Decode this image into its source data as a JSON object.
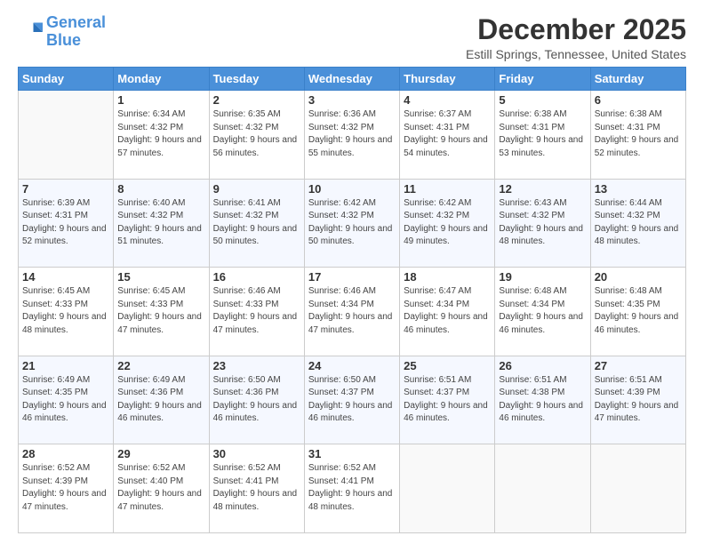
{
  "logo": {
    "line1": "General",
    "line2": "Blue"
  },
  "header": {
    "title": "December 2025",
    "subtitle": "Estill Springs, Tennessee, United States"
  },
  "weekdays": [
    "Sunday",
    "Monday",
    "Tuesday",
    "Wednesday",
    "Thursday",
    "Friday",
    "Saturday"
  ],
  "weeks": [
    [
      {
        "day": "",
        "sunrise": "",
        "sunset": "",
        "daylight": ""
      },
      {
        "day": "1",
        "sunrise": "Sunrise: 6:34 AM",
        "sunset": "Sunset: 4:32 PM",
        "daylight": "Daylight: 9 hours and 57 minutes."
      },
      {
        "day": "2",
        "sunrise": "Sunrise: 6:35 AM",
        "sunset": "Sunset: 4:32 PM",
        "daylight": "Daylight: 9 hours and 56 minutes."
      },
      {
        "day": "3",
        "sunrise": "Sunrise: 6:36 AM",
        "sunset": "Sunset: 4:32 PM",
        "daylight": "Daylight: 9 hours and 55 minutes."
      },
      {
        "day": "4",
        "sunrise": "Sunrise: 6:37 AM",
        "sunset": "Sunset: 4:31 PM",
        "daylight": "Daylight: 9 hours and 54 minutes."
      },
      {
        "day": "5",
        "sunrise": "Sunrise: 6:38 AM",
        "sunset": "Sunset: 4:31 PM",
        "daylight": "Daylight: 9 hours and 53 minutes."
      },
      {
        "day": "6",
        "sunrise": "Sunrise: 6:38 AM",
        "sunset": "Sunset: 4:31 PM",
        "daylight": "Daylight: 9 hours and 52 minutes."
      }
    ],
    [
      {
        "day": "7",
        "sunrise": "Sunrise: 6:39 AM",
        "sunset": "Sunset: 4:31 PM",
        "daylight": "Daylight: 9 hours and 52 minutes."
      },
      {
        "day": "8",
        "sunrise": "Sunrise: 6:40 AM",
        "sunset": "Sunset: 4:32 PM",
        "daylight": "Daylight: 9 hours and 51 minutes."
      },
      {
        "day": "9",
        "sunrise": "Sunrise: 6:41 AM",
        "sunset": "Sunset: 4:32 PM",
        "daylight": "Daylight: 9 hours and 50 minutes."
      },
      {
        "day": "10",
        "sunrise": "Sunrise: 6:42 AM",
        "sunset": "Sunset: 4:32 PM",
        "daylight": "Daylight: 9 hours and 50 minutes."
      },
      {
        "day": "11",
        "sunrise": "Sunrise: 6:42 AM",
        "sunset": "Sunset: 4:32 PM",
        "daylight": "Daylight: 9 hours and 49 minutes."
      },
      {
        "day": "12",
        "sunrise": "Sunrise: 6:43 AM",
        "sunset": "Sunset: 4:32 PM",
        "daylight": "Daylight: 9 hours and 48 minutes."
      },
      {
        "day": "13",
        "sunrise": "Sunrise: 6:44 AM",
        "sunset": "Sunset: 4:32 PM",
        "daylight": "Daylight: 9 hours and 48 minutes."
      }
    ],
    [
      {
        "day": "14",
        "sunrise": "Sunrise: 6:45 AM",
        "sunset": "Sunset: 4:33 PM",
        "daylight": "Daylight: 9 hours and 48 minutes."
      },
      {
        "day": "15",
        "sunrise": "Sunrise: 6:45 AM",
        "sunset": "Sunset: 4:33 PM",
        "daylight": "Daylight: 9 hours and 47 minutes."
      },
      {
        "day": "16",
        "sunrise": "Sunrise: 6:46 AM",
        "sunset": "Sunset: 4:33 PM",
        "daylight": "Daylight: 9 hours and 47 minutes."
      },
      {
        "day": "17",
        "sunrise": "Sunrise: 6:46 AM",
        "sunset": "Sunset: 4:34 PM",
        "daylight": "Daylight: 9 hours and 47 minutes."
      },
      {
        "day": "18",
        "sunrise": "Sunrise: 6:47 AM",
        "sunset": "Sunset: 4:34 PM",
        "daylight": "Daylight: 9 hours and 46 minutes."
      },
      {
        "day": "19",
        "sunrise": "Sunrise: 6:48 AM",
        "sunset": "Sunset: 4:34 PM",
        "daylight": "Daylight: 9 hours and 46 minutes."
      },
      {
        "day": "20",
        "sunrise": "Sunrise: 6:48 AM",
        "sunset": "Sunset: 4:35 PM",
        "daylight": "Daylight: 9 hours and 46 minutes."
      }
    ],
    [
      {
        "day": "21",
        "sunrise": "Sunrise: 6:49 AM",
        "sunset": "Sunset: 4:35 PM",
        "daylight": "Daylight: 9 hours and 46 minutes."
      },
      {
        "day": "22",
        "sunrise": "Sunrise: 6:49 AM",
        "sunset": "Sunset: 4:36 PM",
        "daylight": "Daylight: 9 hours and 46 minutes."
      },
      {
        "day": "23",
        "sunrise": "Sunrise: 6:50 AM",
        "sunset": "Sunset: 4:36 PM",
        "daylight": "Daylight: 9 hours and 46 minutes."
      },
      {
        "day": "24",
        "sunrise": "Sunrise: 6:50 AM",
        "sunset": "Sunset: 4:37 PM",
        "daylight": "Daylight: 9 hours and 46 minutes."
      },
      {
        "day": "25",
        "sunrise": "Sunrise: 6:51 AM",
        "sunset": "Sunset: 4:37 PM",
        "daylight": "Daylight: 9 hours and 46 minutes."
      },
      {
        "day": "26",
        "sunrise": "Sunrise: 6:51 AM",
        "sunset": "Sunset: 4:38 PM",
        "daylight": "Daylight: 9 hours and 46 minutes."
      },
      {
        "day": "27",
        "sunrise": "Sunrise: 6:51 AM",
        "sunset": "Sunset: 4:39 PM",
        "daylight": "Daylight: 9 hours and 47 minutes."
      }
    ],
    [
      {
        "day": "28",
        "sunrise": "Sunrise: 6:52 AM",
        "sunset": "Sunset: 4:39 PM",
        "daylight": "Daylight: 9 hours and 47 minutes."
      },
      {
        "day": "29",
        "sunrise": "Sunrise: 6:52 AM",
        "sunset": "Sunset: 4:40 PM",
        "daylight": "Daylight: 9 hours and 47 minutes."
      },
      {
        "day": "30",
        "sunrise": "Sunrise: 6:52 AM",
        "sunset": "Sunset: 4:41 PM",
        "daylight": "Daylight: 9 hours and 48 minutes."
      },
      {
        "day": "31",
        "sunrise": "Sunrise: 6:52 AM",
        "sunset": "Sunset: 4:41 PM",
        "daylight": "Daylight: 9 hours and 48 minutes."
      },
      {
        "day": "",
        "sunrise": "",
        "sunset": "",
        "daylight": ""
      },
      {
        "day": "",
        "sunrise": "",
        "sunset": "",
        "daylight": ""
      },
      {
        "day": "",
        "sunrise": "",
        "sunset": "",
        "daylight": ""
      }
    ]
  ]
}
